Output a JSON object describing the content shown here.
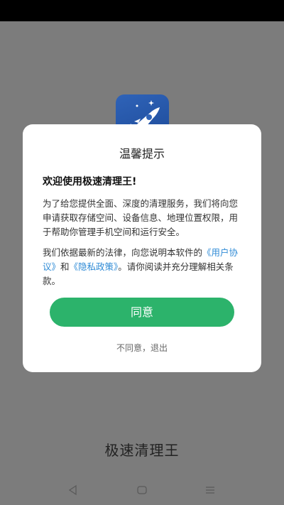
{
  "app": {
    "name": "极速清理王"
  },
  "dialog": {
    "title": "温馨提示",
    "welcome": "欢迎使用极速清理王!",
    "paragraph1": "为了给您提供全面、深度的清理服务，我们将向您申请获取存储空间、设备信息、地理位置权限，用于帮助你管理手机空间和运行安全。",
    "paragraph2_prefix": "我们依据最新的法律，向您说明本软件的",
    "user_agreement_link": "《用户协议》",
    "and_text": "和",
    "privacy_policy_link": "《隐私政策》",
    "paragraph2_suffix": "。请你阅读并充分理解相关条款。",
    "agree_label": "同意",
    "disagree_label": "不同意，退出"
  },
  "colors": {
    "accent": "#2cb36b",
    "link": "#2f8bd6",
    "overlay": "#7c7c7c"
  },
  "icons": {
    "app_icon": "rocket-icon",
    "nav_back": "back-triangle-icon",
    "nav_home": "home-rounded-square-icon",
    "nav_menu": "menu-lines-icon"
  }
}
